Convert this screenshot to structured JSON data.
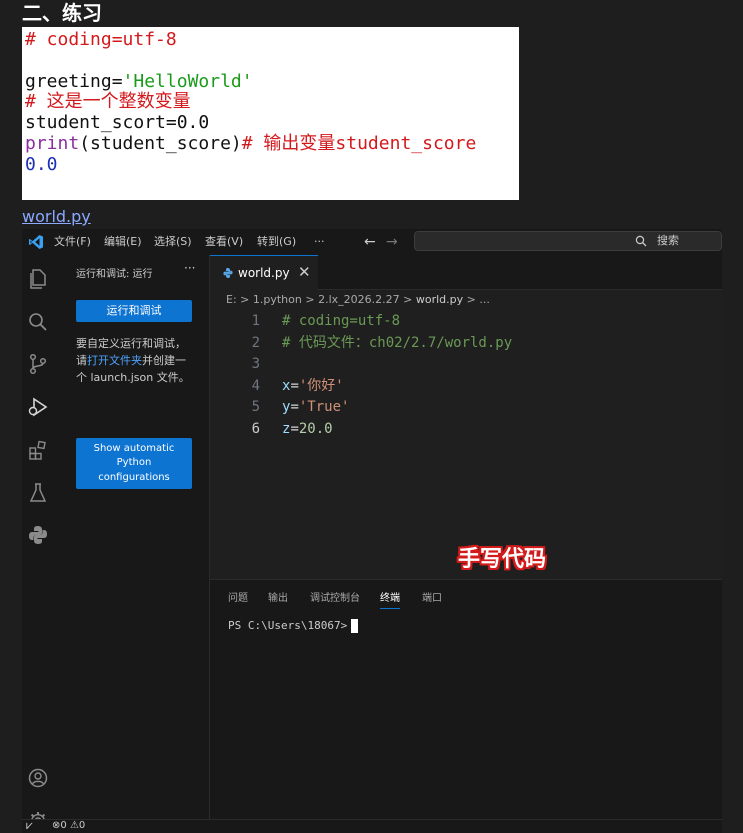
{
  "doc": {
    "heading": "二、练习",
    "code_lines": [
      {
        "parts": [
          {
            "t": "# coding=utf-8",
            "c": "red"
          }
        ]
      },
      {
        "parts": [
          {
            "t": "",
            "c": "black"
          }
        ]
      },
      {
        "parts": [
          {
            "t": "greeting=",
            "c": "black"
          },
          {
            "t": "'HelloWorld'",
            "c": "green"
          }
        ]
      },
      {
        "parts": [
          {
            "t": "# 这是一个整数变量",
            "c": "red"
          }
        ]
      },
      {
        "parts": [
          {
            "t": "student_scort=0.0",
            "c": "black"
          }
        ]
      },
      {
        "parts": [
          {
            "t": "print",
            "c": "purple"
          },
          {
            "t": "(student_score)",
            "c": "black"
          },
          {
            "t": "# 输出变量student_score",
            "c": "red"
          }
        ]
      },
      {
        "parts": [
          {
            "t": "0.0",
            "c": "blue"
          }
        ]
      }
    ],
    "file_link": "world.py"
  },
  "titlebar": {
    "menus": [
      "文件(F)",
      "编辑(E)",
      "选择(S)",
      "查看(V)",
      "转到(G)",
      "···"
    ],
    "back": "←",
    "forward": "→",
    "search_label": "搜索"
  },
  "sidebar": {
    "title": "运行和调试: 运行",
    "more": "···",
    "run_button": "运行和调试",
    "desc_pre": "要自定义运行和调试，请",
    "desc_link": "打开文件夹",
    "desc_post": "并创建一个 launch.json 文件。",
    "show_config_button": "Show automatic Python configurations"
  },
  "editor": {
    "tab_label": "world.py",
    "tab_close": "✕",
    "breadcrumb": "E: > 1.python > 2.lx_2026.2.27 > world.py > ...",
    "breadcrumb_parts": [
      "E:",
      "1.python",
      "2.lx_2026.2.27",
      "world.py",
      "..."
    ],
    "lines": [
      {
        "no": "1",
        "parts": [
          {
            "t": "# coding=utf-8",
            "k": "comment"
          }
        ]
      },
      {
        "no": "2",
        "parts": [
          {
            "t": "# 代码文件：ch02/2.7/world.py",
            "k": "comment"
          }
        ]
      },
      {
        "no": "3",
        "parts": [
          {
            "t": "",
            "k": "op"
          }
        ]
      },
      {
        "no": "4",
        "parts": [
          {
            "t": "x",
            "k": "var"
          },
          {
            "t": "=",
            "k": "op"
          },
          {
            "t": "'你好'",
            "k": "str"
          }
        ]
      },
      {
        "no": "5",
        "parts": [
          {
            "t": "y",
            "k": "var"
          },
          {
            "t": "=",
            "k": "op"
          },
          {
            "t": "'True'",
            "k": "str"
          }
        ]
      },
      {
        "no": "6",
        "parts": [
          {
            "t": "z",
            "k": "var"
          },
          {
            "t": "=",
            "k": "op"
          },
          {
            "t": "20.0",
            "k": "num"
          }
        ]
      }
    ],
    "active_line": "6",
    "overlay_text": "手写代码"
  },
  "panel": {
    "tabs": [
      "问题",
      "输出",
      "调试控制台",
      "终端",
      "端口"
    ],
    "active_tab": "终端",
    "prompt": "PS C:\\Users\\18067>"
  },
  "statusbar": {
    "remote": "⩗",
    "errors": "0",
    "warnings": "0"
  },
  "colors": {
    "accent": "#0e74d2",
    "editor_bg": "#1f1f1f",
    "chrome_bg": "#181818"
  }
}
